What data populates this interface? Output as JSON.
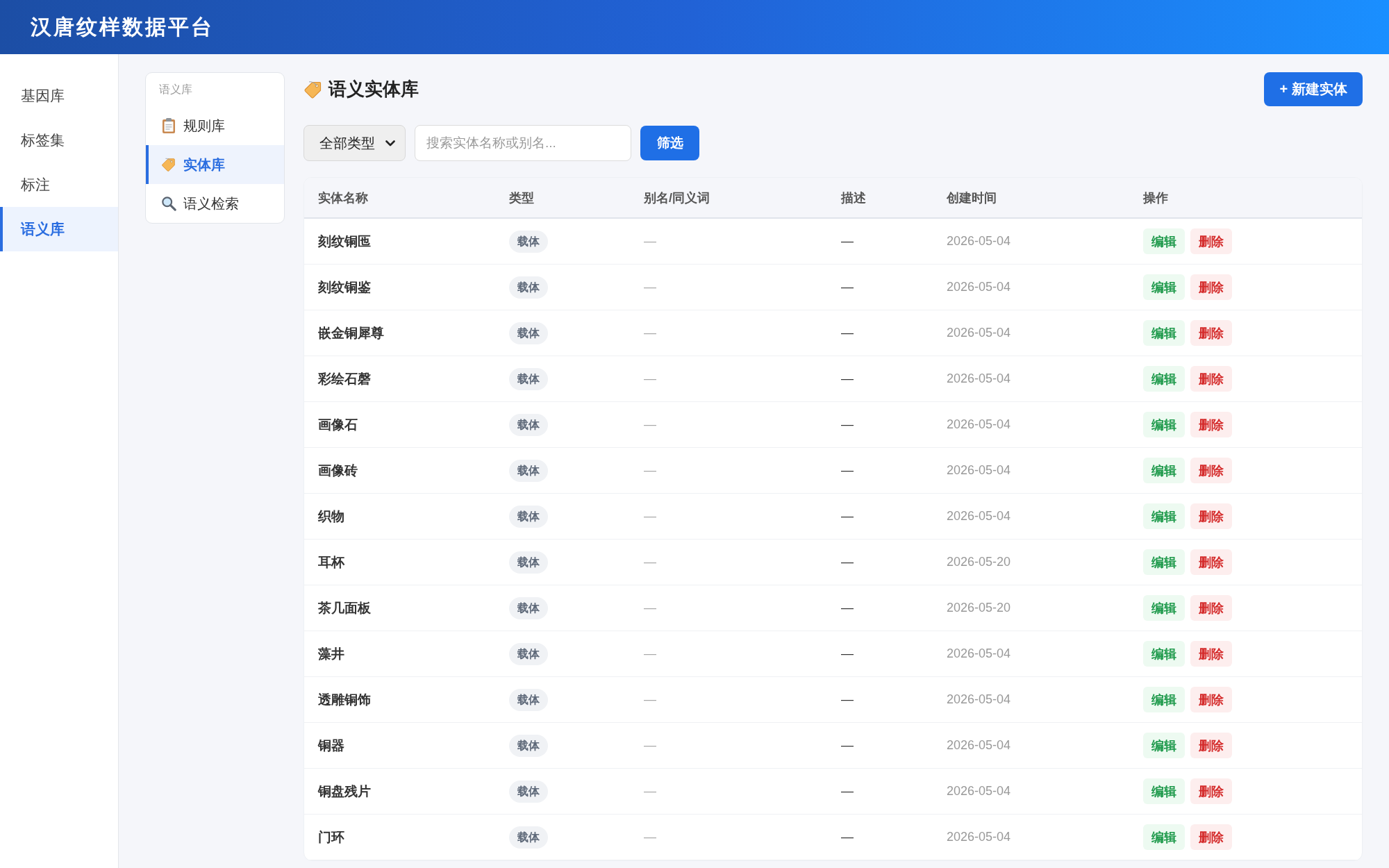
{
  "header": {
    "title": "汉唐纹样数据平台"
  },
  "sidebar": {
    "items": [
      {
        "label": "基因库",
        "selected": false
      },
      {
        "label": "标签集",
        "selected": false
      },
      {
        "label": "标注",
        "selected": false
      },
      {
        "label": "语义库",
        "selected": true
      }
    ]
  },
  "subnav": {
    "heading": "语义库",
    "items": [
      {
        "label": "规则库",
        "selected": false
      },
      {
        "label": "实体库",
        "selected": true
      },
      {
        "label": "语义检索",
        "selected": false
      }
    ]
  },
  "page": {
    "title": "语义实体库",
    "new_button": "+ 新建实体"
  },
  "filters": {
    "type_select": {
      "value": "全部类型"
    },
    "search": {
      "placeholder": "搜索实体名称或别名..."
    },
    "button": "筛选"
  },
  "table": {
    "columns": [
      "实体名称",
      "类型",
      "别名/同义词",
      "描述",
      "创建时间",
      "操作"
    ],
    "rows": [
      {
        "name": "刻纹铜匜",
        "type": "载体",
        "aliases": "—",
        "description": "—",
        "created": "2026-05-04",
        "actions": [
          {
            "kind": "edit",
            "label": "编辑"
          },
          {
            "kind": "delete",
            "label": "删除"
          }
        ]
      },
      {
        "name": "刻纹铜鉴",
        "type": "载体",
        "aliases": "—",
        "description": "—",
        "created": "2026-05-04",
        "actions": [
          {
            "kind": "edit",
            "label": "编辑"
          },
          {
            "kind": "delete",
            "label": "删除"
          }
        ]
      },
      {
        "name": "嵌金铜犀尊",
        "type": "载体",
        "aliases": "—",
        "description": "—",
        "created": "2026-05-04",
        "actions": [
          {
            "kind": "edit",
            "label": "编辑"
          },
          {
            "kind": "delete",
            "label": "删除"
          }
        ]
      },
      {
        "name": "彩绘石磬",
        "type": "载体",
        "aliases": "—",
        "description": "—",
        "created": "2026-05-04",
        "actions": [
          {
            "kind": "edit",
            "label": "编辑"
          },
          {
            "kind": "delete",
            "label": "删除"
          }
        ]
      },
      {
        "name": "画像石",
        "type": "载体",
        "aliases": "—",
        "description": "—",
        "created": "2026-05-04",
        "actions": [
          {
            "kind": "edit",
            "label": "编辑"
          },
          {
            "kind": "delete",
            "label": "删除"
          }
        ]
      },
      {
        "name": "画像砖",
        "type": "载体",
        "aliases": "—",
        "description": "—",
        "created": "2026-05-04",
        "actions": [
          {
            "kind": "edit",
            "label": "编辑"
          },
          {
            "kind": "delete",
            "label": "删除"
          }
        ]
      },
      {
        "name": "织物",
        "type": "载体",
        "aliases": "—",
        "description": "—",
        "created": "2026-05-04",
        "actions": [
          {
            "kind": "edit",
            "label": "编辑"
          },
          {
            "kind": "delete",
            "label": "删除"
          }
        ]
      },
      {
        "name": "耳杯",
        "type": "载体",
        "aliases": "—",
        "description": "—",
        "created": "2026-05-20",
        "actions": [
          {
            "kind": "edit",
            "label": "编辑"
          },
          {
            "kind": "delete",
            "label": "删除"
          }
        ]
      },
      {
        "name": "茶几面板",
        "type": "载体",
        "aliases": "—",
        "description": "—",
        "created": "2026-05-20",
        "actions": [
          {
            "kind": "edit",
            "label": "编辑"
          },
          {
            "kind": "delete",
            "label": "删除"
          }
        ]
      },
      {
        "name": "藻井",
        "type": "载体",
        "aliases": "—",
        "description": "—",
        "created": "2026-05-04",
        "actions": [
          {
            "kind": "edit",
            "label": "编辑"
          },
          {
            "kind": "delete",
            "label": "删除"
          }
        ]
      },
      {
        "name": "透雕铜饰",
        "type": "载体",
        "aliases": "—",
        "description": "—",
        "created": "2026-05-04",
        "actions": [
          {
            "kind": "edit",
            "label": "编辑"
          },
          {
            "kind": "delete",
            "label": "删除"
          }
        ]
      },
      {
        "name": "铜器",
        "type": "载体",
        "aliases": "—",
        "description": "—",
        "created": "2026-05-04",
        "actions": [
          {
            "kind": "edit",
            "label": "编辑"
          },
          {
            "kind": "delete",
            "label": "删除"
          }
        ]
      },
      {
        "name": "铜盘残片",
        "type": "载体",
        "aliases": "—",
        "description": "—",
        "created": "2026-05-04",
        "actions": [
          {
            "kind": "edit",
            "label": "编辑"
          },
          {
            "kind": "delete",
            "label": "删除"
          }
        ]
      },
      {
        "name": "门环",
        "type": "载体",
        "aliases": "—",
        "description": "—",
        "created": "2026-05-04",
        "actions": [
          {
            "kind": "edit",
            "label": "编辑"
          },
          {
            "kind": "delete",
            "label": "删除"
          }
        ]
      }
    ]
  }
}
